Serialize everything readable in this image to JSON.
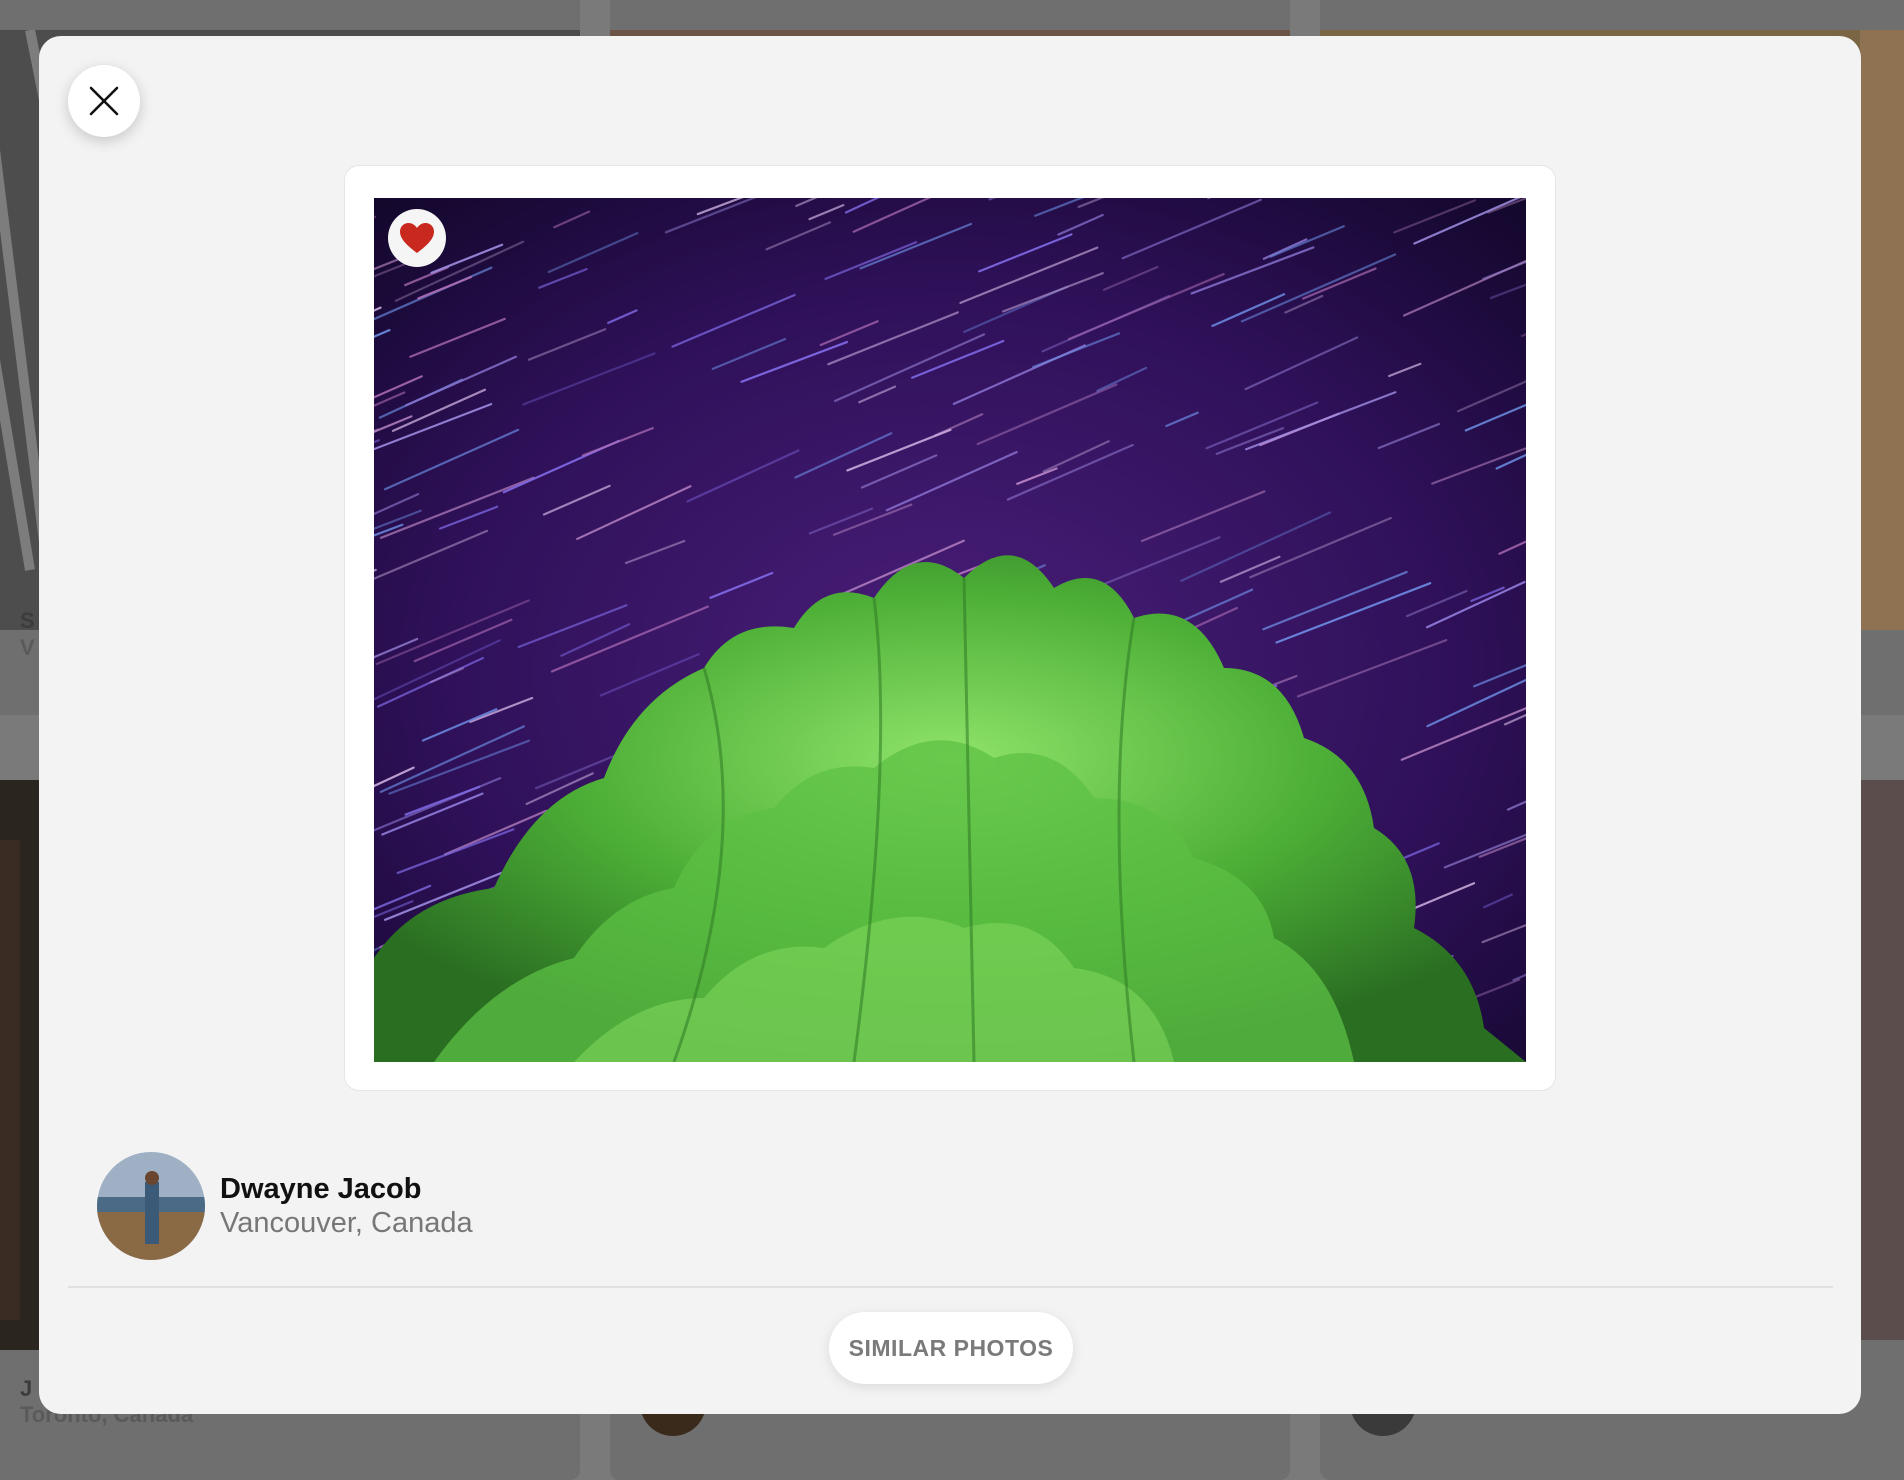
{
  "background": {
    "captions": [
      {
        "name": "S",
        "location": "V"
      },
      {
        "name": "J",
        "location": "Toronto, Canada"
      }
    ]
  },
  "modal": {
    "close_icon": "close-icon",
    "photo": {
      "like_icon": "heart-icon",
      "liked": true,
      "like_color": "#c8281e"
    },
    "author": {
      "name": "Dwayne Jacob",
      "location": "Vancouver, Canada"
    },
    "similar_button_label": "SIMILAR PHOTOS"
  }
}
